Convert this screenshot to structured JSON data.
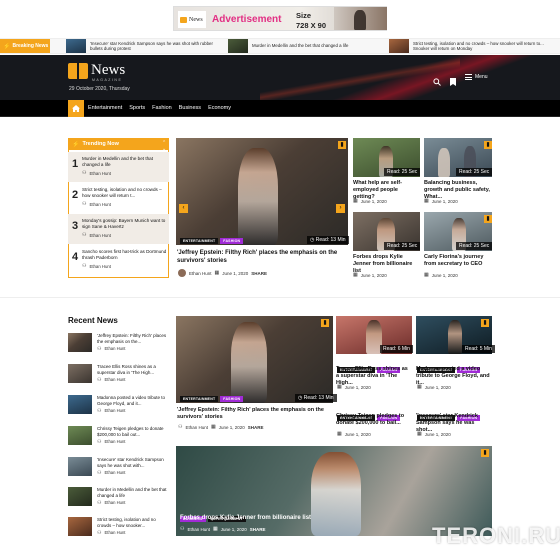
{
  "ad": {
    "logo": "News",
    "logo_sub": "magazine",
    "title": "Advertisement",
    "size_label": "Size",
    "size_value": "728 X 90"
  },
  "breaking": {
    "label": "Breaking News",
    "items": [
      {
        "text": "'Insecure' star Kendrick Sampson says he was shot with rubber bullets during protest"
      },
      {
        "text": "Murder in Medellin and the bet that changed a life"
      },
      {
        "text": "Strict testing, isolation and no crowds – how snooker will return to... Snooker will return on Monday"
      }
    ]
  },
  "header": {
    "logo": "News",
    "logo_sub": "magazine",
    "date": "29 October 2020, Thursday",
    "menu_label": "Menu"
  },
  "nav": {
    "items": [
      "Entertainment",
      "Sports",
      "Fashion",
      "Business",
      "Economy"
    ]
  },
  "trending": {
    "title": "Trending Now",
    "items": [
      {
        "num": "1",
        "title": "Murder in Medellin and the bet that changed a life",
        "author": "Ethan Hunt"
      },
      {
        "num": "2",
        "title": "Strict testing, isolation and no crowds – how snooker will return t...",
        "author": "Ethan Hunt"
      },
      {
        "num": "3",
        "title": "Monday's gossip: Bayern Munich want to sign Sane & Havertz",
        "author": "Ethan Hunt"
      },
      {
        "num": "4",
        "title": "Sancho scores first hat-trick as Dortmund thrash Paderborn",
        "author": "Ethan Hunt"
      }
    ]
  },
  "featured": {
    "tags": [
      "ENTERTAINMENT",
      "FASHION"
    ],
    "read": "Read: 13 Min",
    "title": "'Jeffrey Epstein: Filthy Rich' places the emphasis on the survivors' stories",
    "author": "Ethan Hunt",
    "date": "June 1, 2020",
    "share": "SHARE"
  },
  "side_grid": [
    {
      "read": "Read: 25 Sec",
      "title": "What help are self-employed people getting?",
      "date": "June 1, 2020"
    },
    {
      "read": "Read: 25 Sec",
      "title": "Balancing business, growth and public safety, What...",
      "date": "June 1, 2020"
    },
    {
      "read": "Read: 25 Sec",
      "title": "Forbes drops Kylie Jenner from billionaire list",
      "date": "June 1, 2020"
    },
    {
      "read": "Read: 25 Sec",
      "title": "Carly Fiorina's journey from secretary to CEO",
      "date": "June 1, 2020"
    }
  ],
  "recent": {
    "title": "Recent News",
    "items": [
      {
        "title": "'Jeffrey Epstein: Filthy Rich' places the emphasis on the...",
        "author": "Ethan Hunt"
      },
      {
        "title": "Tracee Ellis Ross shines as a superstar diva in 'The High...",
        "author": "Ethan Hunt"
      },
      {
        "title": "Madonna posted a video tribute to George Floyd, and it...",
        "author": "Ethan Hunt"
      },
      {
        "title": "Chrissy Teigen pledges to donate $200,000 to bail out...",
        "author": "Ethan Hunt"
      },
      {
        "title": "'Insecure' star Kendrick Sampson says he was shot with...",
        "author": "Ethan Hunt"
      },
      {
        "title": "Murder in Medellin and the bet that changed a life",
        "author": "Ethan Hunt"
      },
      {
        "title": "Strict testing, isolation and no crowds – how snooker...",
        "author": "Ethan Hunt"
      }
    ]
  },
  "recent_main": {
    "tags": [
      "ENTERTAINMENT",
      "FASHION"
    ],
    "read": "Read: 13 Min",
    "title": "'Jeffrey Epstein: Filthy Rich' places the emphasis on the survivors' stories",
    "author": "Ethan Hunt",
    "date": "June 1, 2020",
    "share": "SHARE"
  },
  "recent_grid": [
    {
      "read": "Read: 6 Min",
      "tags": [
        "ENTERTAINMENT",
        "FASHION"
      ],
      "title": "Tracee Ellis Ross shines as a superstar diva in 'The High...",
      "date": "June 1, 2020"
    },
    {
      "read": "Read: 5 Min",
      "tags": [
        "ENTERTAINMENT",
        "FASHION"
      ],
      "title": "Madonna posted a video tribute to George Floyd, and it...",
      "date": "June 1, 2020"
    },
    {
      "read": "",
      "tags": [
        "ENTERTAINMENT",
        "FASHION"
      ],
      "title": "Chrissy Teigen pledges to donate $200,000 to bail...",
      "date": "June 1, 2020"
    },
    {
      "read": "",
      "tags": [
        "ENTERTAINMENT",
        "FASHION"
      ],
      "title": "'Insecure' star Kendrick Sampson says he was shot...",
      "date": "June 1, 2020"
    }
  ],
  "bottom": {
    "tags": [
      "BUSINESS",
      "ENTERTAINMENT"
    ],
    "title": "Forbes drops Kylie Jenner from billionaire list",
    "author": "Ethan Hunt",
    "date": "June 1, 2020",
    "share": "SHARE"
  },
  "watermark": "TERONI.RU",
  "colors": {
    "accent": "#f4a51c",
    "dark": "#111111",
    "fashion": "#a02bd6"
  }
}
